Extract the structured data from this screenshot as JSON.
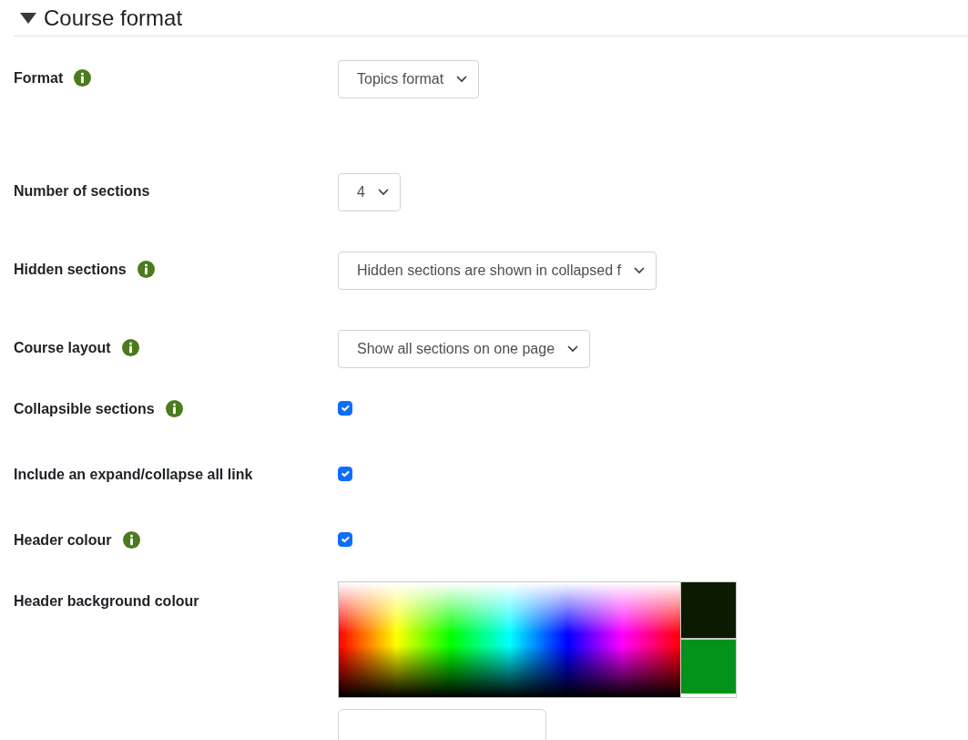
{
  "section": {
    "title": "Course format",
    "expanded": true
  },
  "rows": [
    {
      "kind": "select",
      "label": "Format",
      "help": true,
      "value": "Topics format"
    },
    {
      "kind": "select",
      "label": "Number of sections",
      "help": false,
      "value": "4"
    },
    {
      "kind": "select",
      "label": "Hidden sections",
      "help": true,
      "value": "Hidden sections are shown in collapsed f"
    },
    {
      "kind": "select",
      "label": "Course layout",
      "help": true,
      "value": "Show all sections on one page"
    },
    {
      "kind": "checkbox",
      "label": "Collapsible sections",
      "help": true,
      "checked": true
    },
    {
      "kind": "checkbox",
      "label": "Include an expand/collapse all link",
      "help": false,
      "checked": true
    },
    {
      "kind": "checkbox",
      "label": "Header colour",
      "help": true,
      "checked": true
    },
    {
      "kind": "colorpicker",
      "label": "Header background colour",
      "help": false,
      "swatches": [
        {
          "color": "#0b1a00"
        },
        {
          "color": "#05921a"
        }
      ],
      "hex_field": true
    }
  ]
}
